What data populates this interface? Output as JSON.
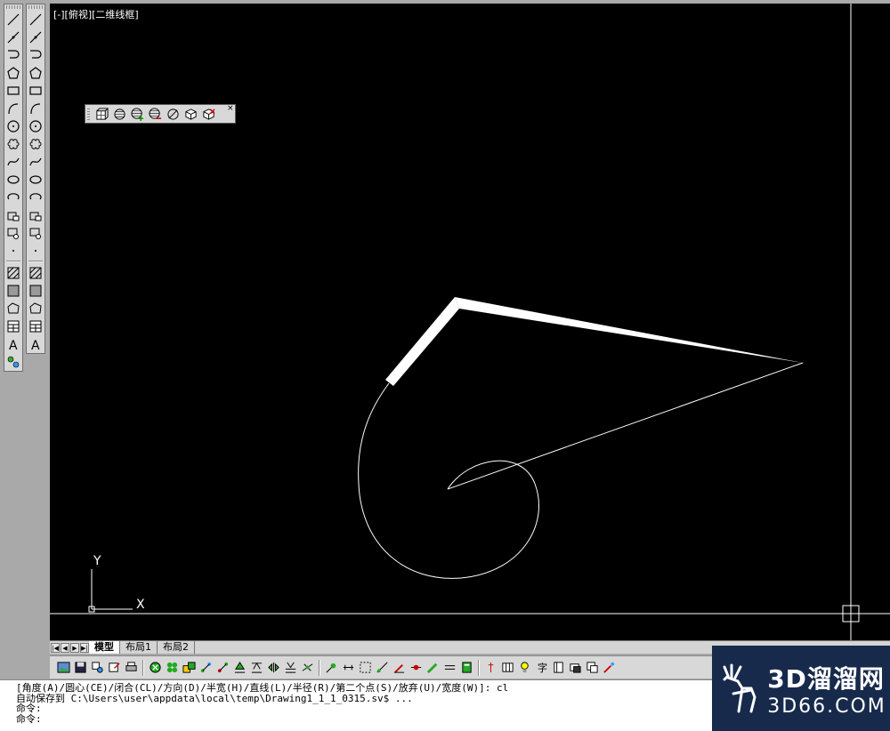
{
  "viewport": {
    "label": "[-][俯视][二维线框]",
    "background": "#000000",
    "ucs_x": "X",
    "ucs_y": "Y"
  },
  "layout_tabs": {
    "tabs": [
      "模型",
      "布局1",
      "布局2"
    ],
    "active": "模型"
  },
  "command_line": {
    "lines": [
      "[角度(A)/圆心(CE)/闭合(CL)/方向(D)/半宽(H)/直线(L)/半径(R)/第二个点(S)/放弃(U)/宽度(W)]: cl",
      "自动保存到 C:\\Users\\user\\appdata\\local\\temp\\Drawing1_1_1_0315.sv$ ...",
      "命令:",
      "命令:"
    ]
  },
  "watermark": {
    "main": "3D溜溜网",
    "sub": "3D66.COM"
  },
  "icons": {
    "left_toolbar": [
      "line-icon",
      "construction-line-icon",
      "polyline-icon",
      "polygon-icon",
      "rectangle-icon",
      "arc-icon",
      "circle-icon",
      "revision-cloud-icon",
      "spline-icon",
      "ellipse-icon",
      "ellipse-arc-icon",
      "insert-block-icon",
      "make-block-icon",
      "point-icon",
      "hatch-icon",
      "gradient-icon",
      "region-icon",
      "table-icon",
      "multiline-text-icon"
    ],
    "float_toolbar": [
      "view-cube-icon",
      "sphere-icon",
      "sphere-add-icon",
      "sphere-remove-icon",
      "no-view-icon",
      "box-view-icon",
      "reset-view-icon"
    ]
  },
  "colors": {
    "toolbar_bg": "#d8d8d8",
    "drawing_stroke": "#ffffff",
    "watermark_bg": "#172a4c"
  }
}
